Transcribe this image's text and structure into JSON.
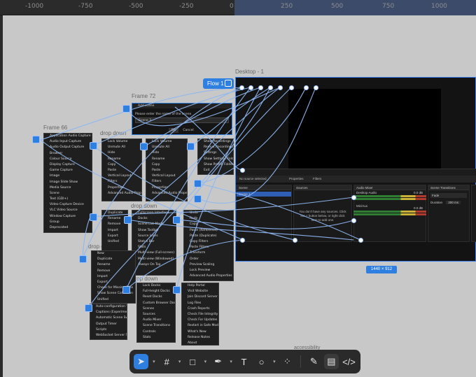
{
  "ruler": {
    "ticks": [
      "-1000",
      "-750",
      "-500",
      "-250",
      "0",
      "250",
      "500",
      "750",
      "1000"
    ]
  },
  "frames": {
    "desktop": "Desktop - 1",
    "frame72": "Frame 72",
    "frame66": "Frame 66",
    "dropdown": "drop down",
    "size": "1440 × 912",
    "flow": "Flow 1",
    "accessibility": "accessibility"
  },
  "dialog": {
    "title": "Add scene",
    "prompt": "Please enter the name of the scene",
    "value": "Scene 3",
    "ok": "OK",
    "cancel": "Cancel"
  },
  "menus": {
    "sources": [
      "Application Audio Capture (BETA)",
      "Audio Input Capture",
      "Audio Output Capture",
      "Browser",
      "Colour Source",
      "Display Capture",
      "Game Capture",
      "Image",
      "Image Slide Show",
      "Media Source",
      "Scene",
      "Text (GDI+)",
      "Video Capture Device",
      "VLC Video Source",
      "Window Capture",
      "Group",
      "Deprecated"
    ],
    "context": [
      "Lock Volume",
      "Unmute All",
      "Hide",
      "Rename",
      "Copy",
      "Paste",
      "Vertical Layout",
      "Filters",
      "Properties",
      "Advanced Audio Properties"
    ],
    "recording": [
      "Show Recordings",
      "Remux Recordings",
      "Settings",
      "Show Settings Folder",
      "Show Profile Folder",
      "Exit"
    ],
    "docks": [
      "Lock Docks",
      "Full-height Docks",
      "Reset Docks",
      "Custom Browser Docks...",
      "Scenes",
      "Sources",
      "Audio Mixer",
      "Scene Transitions",
      "Controls",
      "Stats"
    ],
    "help": [
      "Help Portal",
      "Visit Website",
      "Join Discord Server",
      "Log Files",
      "Crash Reports",
      "Check File Integrity",
      "Check For Updates",
      "Restart in Safe Mode",
      "What's New",
      "Release Notes",
      "About"
    ],
    "tools": [
      "Auto-configuration Wizard",
      "Captions (Experimental)",
      "Automatic Scene Switcher",
      "Output Timer",
      "Scripts",
      "WebSocket Server Settings"
    ],
    "view": [
      "Fullscreen Interface",
      "Docks",
      "Scene List Mode",
      "Show Toolbar",
      "Source Icons",
      "Status Bar",
      "Stats",
      "Multi-view (Full-screen)",
      "Multi-view (Windowed)",
      "Always On Top"
    ],
    "edit": [
      "Undo",
      "Redo",
      "Copy",
      "Paste (Reference)",
      "Paste (Duplicate)",
      "Copy Filters",
      "Paste Filters",
      "Transform",
      "Order",
      "Preview Scaling",
      "Lock Preview",
      "Advanced Audio Properties"
    ],
    "file": [
      "New",
      "Duplicate",
      "Rename",
      "Remove",
      "Import",
      "Export",
      "Check for Missing Files",
      "Show Scene Collection",
      "Unified"
    ],
    "scene_ctx": [
      "Duplicate",
      "Rename",
      "Remove",
      "Import",
      "Export",
      "Unified"
    ]
  },
  "obs": {
    "no_source": "No source selected",
    "properties": "Properties",
    "filters": "Filters",
    "scene_header": "Scene",
    "scene_item": "Scene 1",
    "sources_header": "Sources",
    "sources_hint": "You don't have any sources. Click the + button below, or right click here to add one.",
    "mixer_header": "Audio Mixer",
    "desktop_audio": "Desktop Audio",
    "mic": "Mic/Aux",
    "db1": "0.0 dB",
    "db2": "0.0 dB",
    "transitions_header": "Scene Transitions",
    "transition": "Fade",
    "duration_label": "Duration",
    "duration": "300 ms"
  },
  "toolbar": {
    "tools": [
      "move-tool",
      "frame-tool",
      "shape-tool",
      "pen-tool",
      "text-tool",
      "comment-tool",
      "actions-tool",
      "draw-tool",
      "dev-mode-tool",
      "code-tool"
    ]
  }
}
